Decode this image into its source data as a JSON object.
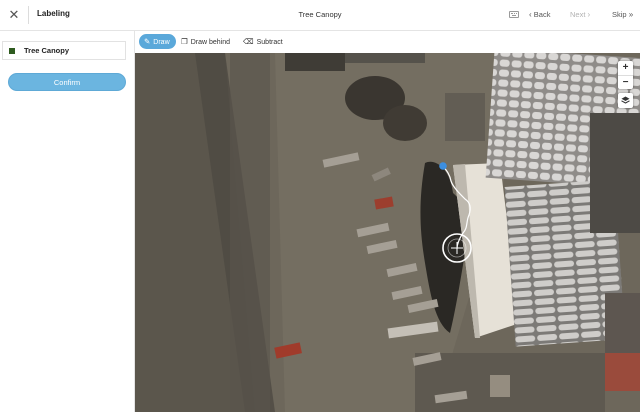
{
  "header": {
    "app_title": "Labeling",
    "task_title": "Tree Canopy",
    "close_icon": "close-icon",
    "keyboard_icon": "keyboard-icon",
    "back_label": "Back",
    "next_label": "Next",
    "skip_label": "Skip"
  },
  "sidebar": {
    "labels": [
      {
        "name": "Tree Canopy",
        "color": "#2e5b1f"
      }
    ],
    "confirm_label": "Confirm"
  },
  "toolbar": {
    "draw_label": "Draw",
    "draw_behind_label": "Draw behind",
    "subtract_label": "Subtract"
  },
  "map_controls": {
    "zoom_in": "+",
    "zoom_out": "−"
  },
  "colors": {
    "accent": "#5aa8da",
    "confirm_bg": "#6bb5e0",
    "label_swatch": "#2e5b1f",
    "draw_line": "#ffffff",
    "vertex": "#3d8fe0"
  }
}
